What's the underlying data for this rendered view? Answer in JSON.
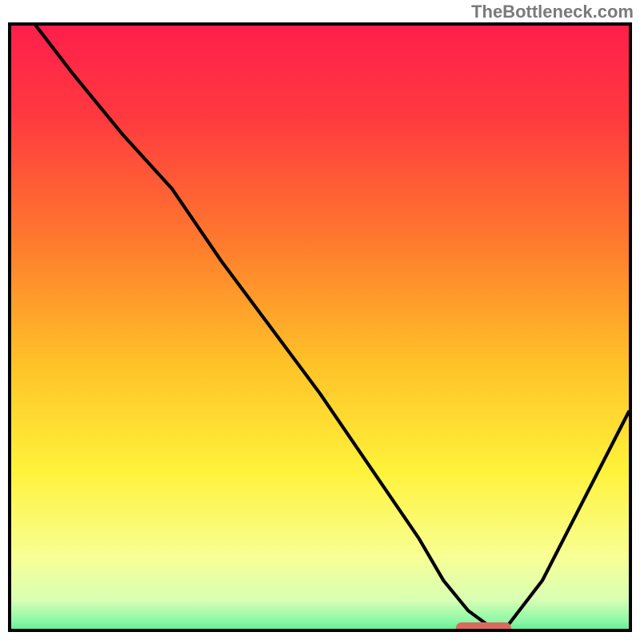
{
  "watermark": "TheBottleneck.com",
  "colors": {
    "border": "#000000",
    "curve": "#000000",
    "marker": "#d96a5f",
    "gradient_stops": [
      {
        "offset": 0.0,
        "color": "#ff1f4b"
      },
      {
        "offset": 0.15,
        "color": "#ff3a3f"
      },
      {
        "offset": 0.35,
        "color": "#ff7a2d"
      },
      {
        "offset": 0.55,
        "color": "#ffc328"
      },
      {
        "offset": 0.72,
        "color": "#fff23a"
      },
      {
        "offset": 0.86,
        "color": "#f8ff94"
      },
      {
        "offset": 0.93,
        "color": "#d8ffb4"
      },
      {
        "offset": 0.965,
        "color": "#89f7a6"
      },
      {
        "offset": 1.0,
        "color": "#26e07a"
      }
    ]
  },
  "chart_data": {
    "type": "line",
    "title": "",
    "xlabel": "",
    "ylabel": "",
    "xlim": [
      0,
      100
    ],
    "ylim": [
      0,
      100
    ],
    "grid": false,
    "series": [
      {
        "name": "curve",
        "x": [
          4,
          10,
          18,
          26,
          34,
          42,
          50,
          58,
          66,
          70,
          74,
          78,
          80,
          86,
          92,
          100
        ],
        "y": [
          100,
          92,
          82,
          73,
          61,
          50,
          39,
          27,
          15,
          8,
          3,
          0,
          0,
          8,
          20,
          36
        ]
      }
    ],
    "marker": {
      "x_start": 72,
      "x_end": 81,
      "y": 0
    }
  }
}
